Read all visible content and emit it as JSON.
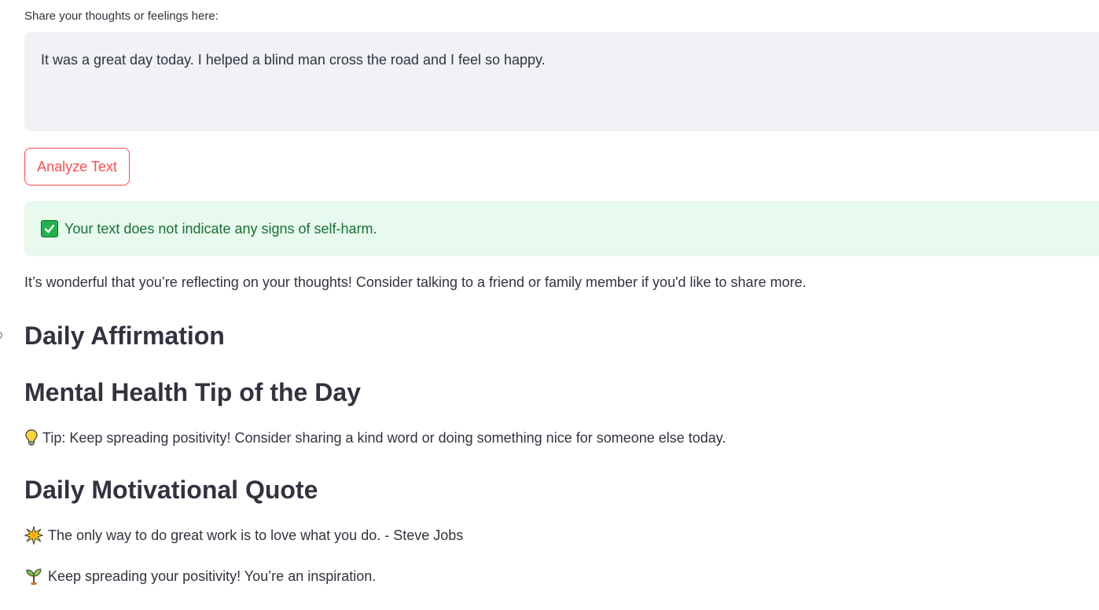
{
  "input": {
    "label": "Share your thoughts or feelings here:",
    "value": "It was a great day today. I helped a blind man cross the road and I feel so happy."
  },
  "actions": {
    "analyze_label": "Analyze Text"
  },
  "result": {
    "success_message": "Your text does not indicate any signs of self-harm.",
    "followup": "It’s wonderful that you’re reflecting on your thoughts! Consider talking to a friend or family member if you'd like to share more."
  },
  "sections": {
    "affirmation_heading": "Daily Affirmation",
    "tip_heading": "Mental Health Tip of the Day",
    "tip_text": "Tip: Keep spreading positivity! Consider sharing a kind word or doing something nice for someone else today.",
    "quote_heading": "Daily Motivational Quote",
    "quote_text": "The only way to do great work is to love what you do. - Steve Jobs",
    "encouragement_text": "Keep spreading your positivity! You’re an inspiration."
  },
  "icons": {
    "check": "check-mark-button-icon",
    "tip": "light-bulb-icon",
    "quote": "sparkle-star-icon",
    "encouragement": "seedling-icon"
  },
  "colors": {
    "accent": "#ff4b4b",
    "success_bg": "#e8f9ee",
    "success_text": "#177233",
    "input_bg": "#f0f2f6"
  }
}
